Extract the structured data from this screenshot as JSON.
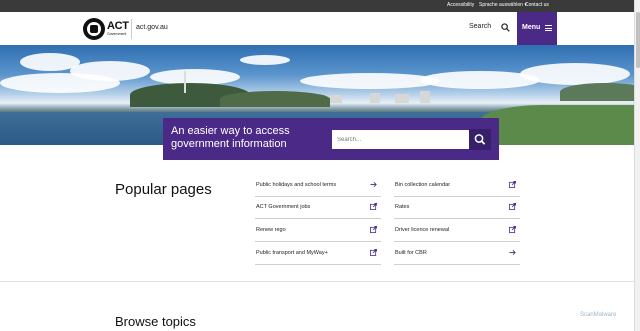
{
  "utility": {
    "accessibility": "Accessibility",
    "language": "Sprache auswählen",
    "contact": "Contact us"
  },
  "header": {
    "logo_text": "ACT",
    "logo_sub": "Government",
    "site_url": "act.gov.au",
    "search_label": "Search",
    "menu_label": "Menu"
  },
  "hero": {
    "title": "An easier way to access government information",
    "search_placeholder": "Search..."
  },
  "popular": {
    "title": "Popular pages",
    "items": [
      {
        "label": "Public holidays and school terms",
        "icon": "arrow-right-icon"
      },
      {
        "label": "Bin collection calendar",
        "icon": "external-link-icon"
      },
      {
        "label": "ACT Government jobs",
        "icon": "external-link-icon"
      },
      {
        "label": "Rates",
        "icon": "external-link-icon"
      },
      {
        "label": "Renew rego",
        "icon": "external-link-icon"
      },
      {
        "label": "Driver licence renewal",
        "icon": "external-link-icon"
      },
      {
        "label": "Public transport and MyWay+",
        "icon": "external-link-icon"
      },
      {
        "label": "Built for CBR",
        "icon": "arrow-right-icon"
      }
    ]
  },
  "browse": {
    "title": "Browse topics"
  },
  "watermark": "ScanMalware",
  "colors": {
    "brand_purple": "#4b2a87",
    "utility_bar": "#3a3a3a"
  }
}
